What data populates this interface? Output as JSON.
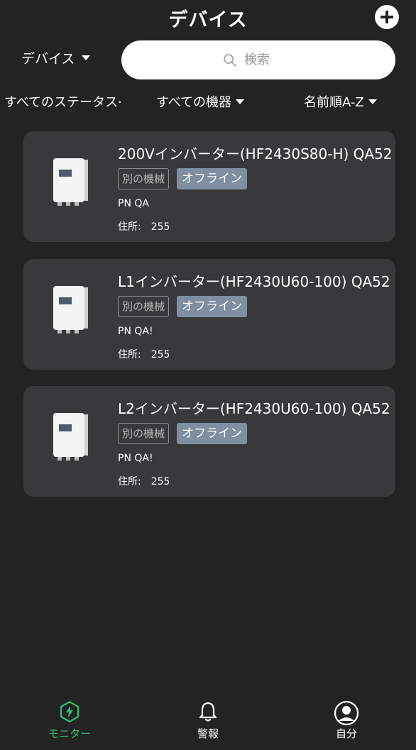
{
  "header": {
    "title": "デバイス",
    "add_icon": "plus-icon"
  },
  "device_select": {
    "label": "デバイス"
  },
  "search": {
    "placeholder": "検索"
  },
  "filters": {
    "status": "すべてのステータス·",
    "type": "すべての機器",
    "sort": "名前順A-Z"
  },
  "devices": [
    {
      "name": "200Vインバーター(HF2430S80-H) QA52",
      "tag_type": "別の機械",
      "tag_status": "オフライン",
      "pn": "PN QA",
      "addr_label": "住所:",
      "addr_value": "255"
    },
    {
      "name": "L1インバーター(HF2430U60-100) QA52",
      "tag_type": "別の機械",
      "tag_status": "オフライン",
      "pn": "PN QA!",
      "addr_label": "住所:",
      "addr_value": "255"
    },
    {
      "name": "L2インバーター(HF2430U60-100) QA52",
      "tag_type": "別の機械",
      "tag_status": "オフライン",
      "pn": "PN QA!",
      "addr_label": "住所:",
      "addr_value": "255"
    }
  ],
  "nav": {
    "monitor": "モニター",
    "alarm": "警報",
    "me": "自分",
    "active_color": "#2fbf71"
  }
}
